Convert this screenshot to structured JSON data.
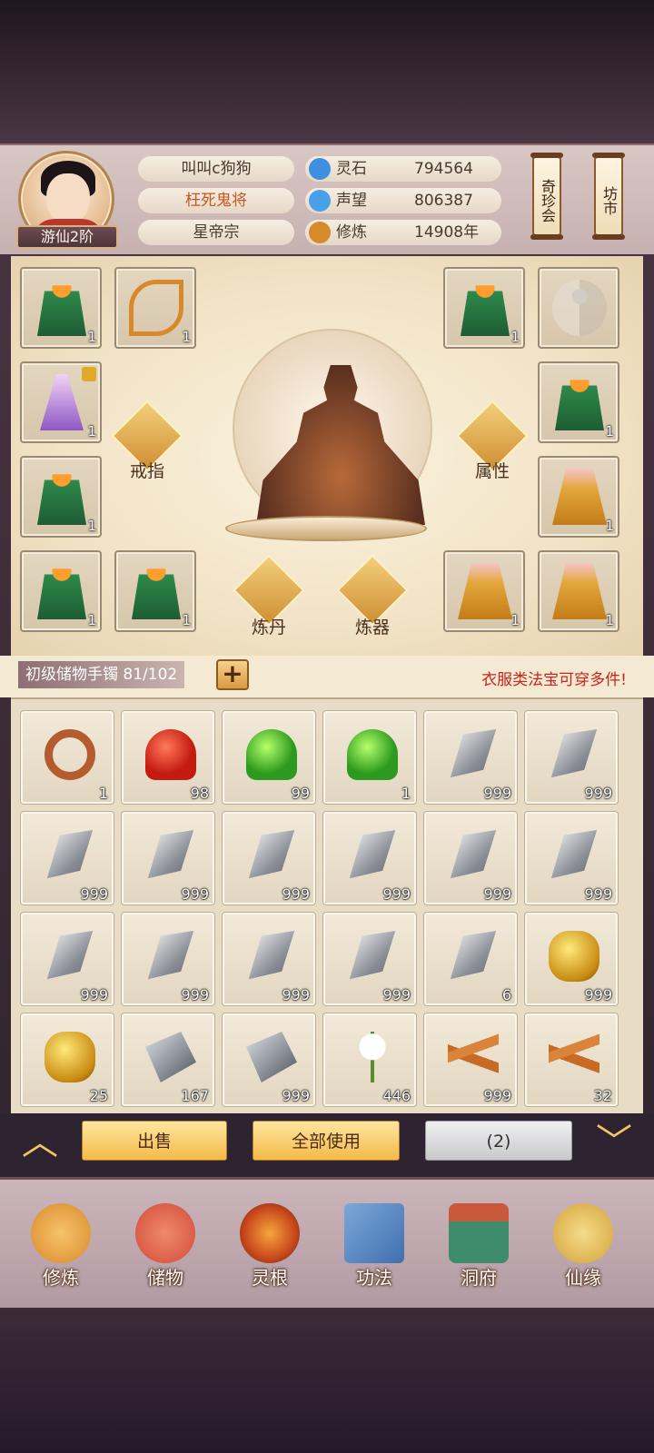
{
  "player": {
    "rank": "游仙2阶",
    "name": "叫叫c狗狗",
    "title": "枉死鬼将",
    "sect": "星帝宗"
  },
  "stats": [
    {
      "label": "灵石",
      "value": "794564",
      "icon": "spirit-stone-icon",
      "color": "#3d8fe0"
    },
    {
      "label": "声望",
      "value": "806387",
      "icon": "reputation-icon",
      "color": "#4aa0e8"
    },
    {
      "label": "修炼",
      "value": "14908年",
      "icon": "meditation-icon",
      "color": "#d68a2a"
    }
  ],
  "header_buttons": {
    "treasure_fair": "奇珍会",
    "market": "坊市"
  },
  "equipment": {
    "left_slots": [
      {
        "item": "green-robe",
        "count": "1"
      },
      {
        "item": "bow",
        "count": "1"
      },
      {
        "item": "fairy-figure",
        "count": "1",
        "locked": true
      },
      {
        "item": "green-robe",
        "count": "1"
      },
      {
        "item": "green-robe",
        "count": "1"
      },
      {
        "item": "green-robe",
        "count": "1"
      }
    ],
    "right_slots": [
      {
        "item": "green-robe",
        "count": "1"
      },
      {
        "item": "empty-yinyang",
        "count": ""
      },
      {
        "item": "green-robe",
        "count": "1"
      },
      {
        "item": "golden-robe",
        "count": "1"
      },
      {
        "item": "golden-robe",
        "count": "1"
      },
      {
        "item": "golden-robe",
        "count": "1"
      }
    ],
    "ring_label": "戒指",
    "attribute_label": "属性",
    "alchemy_label": "炼丹",
    "forge_label": "炼器"
  },
  "storage": {
    "label": "初级储物手镯",
    "capacity": "81/102",
    "note": "衣服类法宝可穿多件!"
  },
  "inventory": [
    {
      "item": "ring",
      "count": "1"
    },
    {
      "item": "red-orb",
      "count": "98"
    },
    {
      "item": "green-orb",
      "count": "99"
    },
    {
      "item": "green-orb",
      "count": "1"
    },
    {
      "item": "silver-stone",
      "count": "999"
    },
    {
      "item": "silver-stone",
      "count": "999"
    },
    {
      "item": "silver-stone",
      "count": "999"
    },
    {
      "item": "silver-stone",
      "count": "999"
    },
    {
      "item": "silver-stone",
      "count": "999"
    },
    {
      "item": "silver-stone",
      "count": "999"
    },
    {
      "item": "silver-stone",
      "count": "999"
    },
    {
      "item": "silver-stone",
      "count": "999"
    },
    {
      "item": "silver-stone",
      "count": "999"
    },
    {
      "item": "silver-stone",
      "count": "999"
    },
    {
      "item": "silver-stone",
      "count": "999"
    },
    {
      "item": "silver-stone",
      "count": "999"
    },
    {
      "item": "silver-stone",
      "count": "6"
    },
    {
      "item": "gold-ore",
      "count": "999"
    },
    {
      "item": "gold-ore",
      "count": "25"
    },
    {
      "item": "iron-ore",
      "count": "167"
    },
    {
      "item": "iron-ore",
      "count": "999"
    },
    {
      "item": "white-flower",
      "count": "446"
    },
    {
      "item": "ginseng-root",
      "count": "999"
    },
    {
      "item": "ginseng-root",
      "count": "32"
    }
  ],
  "actions": {
    "sell": "出售",
    "use_all": "全部使用",
    "selected": "(2)"
  },
  "nav": [
    {
      "label": "修炼",
      "icon": "cultivation-icon",
      "color": "#d98a2c"
    },
    {
      "label": "储物",
      "icon": "storage-bag-icon",
      "color": "#d24a3a"
    },
    {
      "label": "灵根",
      "icon": "spirit-root-icon",
      "color": "#c8471c"
    },
    {
      "label": "功法",
      "icon": "skill-book-icon",
      "color": "#3f6fb0"
    },
    {
      "label": "洞府",
      "icon": "cave-mansion-icon",
      "color": "#3e8c6c"
    },
    {
      "label": "仙缘",
      "icon": "immortal-fate-icon",
      "color": "#d4a23a"
    }
  ]
}
